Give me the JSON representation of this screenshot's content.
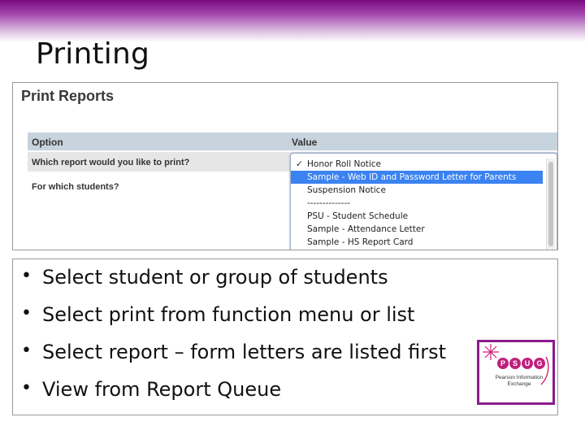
{
  "slide": {
    "title": "Printing",
    "bullets": [
      "Select student or group of students",
      "Select print from function menu or list",
      "Select report – form letters are listed first",
      "View from Report Queue"
    ],
    "bullet_glyph": "•"
  },
  "print_reports": {
    "title": "Print Reports",
    "columns": [
      "Option",
      "Value"
    ],
    "rows": [
      {
        "label": "Which report would you like to print?"
      },
      {
        "label": "For which students?"
      }
    ],
    "dropdown": {
      "options": [
        {
          "text": "Honor Roll Notice",
          "checked": true,
          "selected": false
        },
        {
          "text": "Sample - Web ID and Password Letter for Parents",
          "checked": false,
          "selected": true
        },
        {
          "text": "Suspension Notice",
          "checked": false,
          "selected": false
        },
        {
          "text": "--------------",
          "checked": false,
          "selected": false
        },
        {
          "text": "PSU - Student Schedule",
          "checked": false,
          "selected": false
        },
        {
          "text": "Sample - Attendance Letter",
          "checked": false,
          "selected": false
        },
        {
          "text": "Sample - HS Report Card",
          "checked": false,
          "selected": false
        }
      ],
      "check_glyph": "✓",
      "selected_color": "#3b82f2"
    }
  },
  "logo": {
    "letters": [
      "P",
      "S",
      "U",
      "G"
    ],
    "text": "Pearson Information Exchange",
    "icon": "starburst-logo-icon"
  },
  "colors": {
    "header_band": "#7a0c82",
    "logo_border": "#8a1c8e",
    "logo_accent": "#d1207a"
  }
}
